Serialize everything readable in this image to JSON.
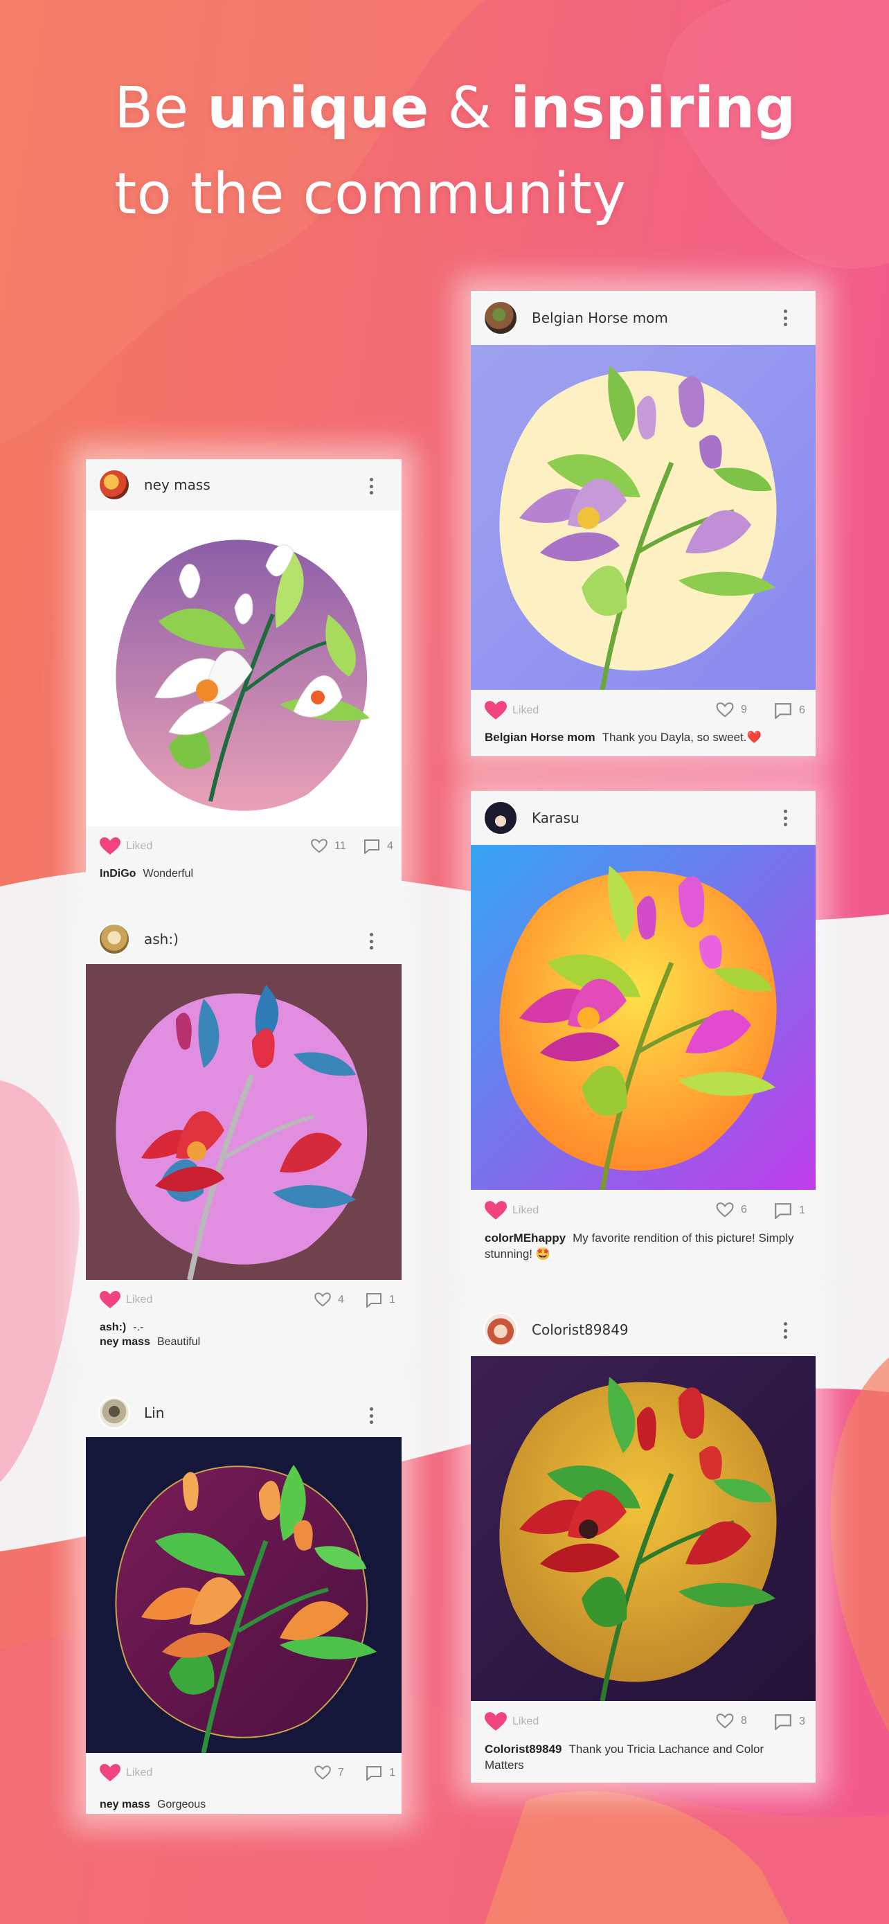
{
  "headline": {
    "line1_pre": "Be ",
    "line1_bold1": "unique",
    "line1_mid": " & ",
    "line1_bold2": "inspiring",
    "line2": "to the community"
  },
  "colors": {
    "background": "#f15f86",
    "accent_heart": "#f2447c",
    "card_bar": "#f6f6f6"
  },
  "cards": [
    {
      "user": "ney mass",
      "liked_label": "Liked",
      "likes": "11",
      "comments": "4",
      "comment_lines": [
        {
          "who": "InDiGo",
          "text": "Wonderful"
        }
      ]
    },
    {
      "user": "ash:)",
      "liked_label": "Liked",
      "likes": "4",
      "comments": "1",
      "comment_lines": [
        {
          "who": "ash:)",
          "text": "-.-"
        },
        {
          "who": "ney mass",
          "text": "Beautiful"
        }
      ]
    },
    {
      "user": "Lin",
      "liked_label": "Liked",
      "likes": "7",
      "comments": "1",
      "comment_lines": [
        {
          "who": "ney mass",
          "text": "Gorgeous"
        }
      ]
    },
    {
      "user": "Belgian Horse mom",
      "liked_label": "Liked",
      "likes": "9",
      "comments": "6",
      "comment_lines": [
        {
          "who": "Belgian Horse mom",
          "text": "Thank you Dayla, so sweet.❤️"
        }
      ]
    },
    {
      "user": "Karasu",
      "liked_label": "Liked",
      "likes": "6",
      "comments": "1",
      "comment_lines": [
        {
          "who": "colorMEhappy",
          "text": "My favorite rendition of this picture! Simply stunning! 🤩"
        }
      ]
    },
    {
      "user": "Colorist89849",
      "liked_label": "Liked",
      "likes": "8",
      "comments": "3",
      "comment_lines": [
        {
          "who": "Colorist89849",
          "text": "Thank you Tricia Lachance and Color Matters"
        }
      ]
    }
  ]
}
